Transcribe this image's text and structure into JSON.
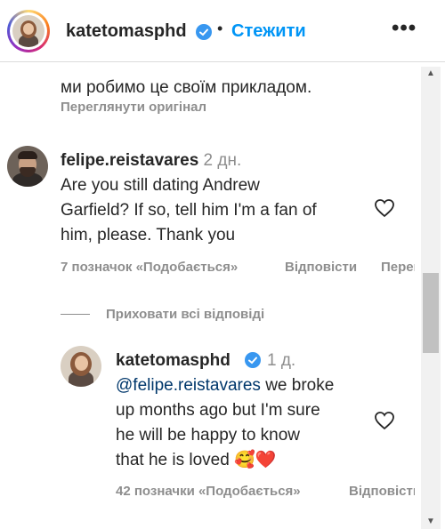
{
  "header": {
    "username": "katetomasphd",
    "separator": "•",
    "follow_label": "Стежити",
    "more_label": "•••"
  },
  "caption_tail": {
    "text": "ми робимо це своїм прикладом.",
    "see_original": "Переглянути оригінал"
  },
  "comment1": {
    "username": "felipe.reistavares",
    "time": "2 дн.",
    "lines": [
      "Are you still dating Andrew",
      "Garfield? If so, tell him I'm a fan of",
      "him, please. Thank you"
    ],
    "likes": "7 позначок «Подобається»",
    "reply": "Відповісти",
    "translate": "Переглянути переклад"
  },
  "hide_replies": "Приховати всі відповіді",
  "reply1": {
    "username": "katetomasphd",
    "time": "1 д.",
    "mention": "@felipe.reistavares",
    "line1_rest": " we broke",
    "lines": [
      "up months ago but I'm sure",
      "he will be happy to know",
      "that he is loved"
    ],
    "emoji": "🥰❤️",
    "likes": "42 позначки «Подобається»",
    "reply": "Відповісти"
  },
  "colors": {
    "accent": "#0095f6",
    "verified": "#3897f0",
    "muted": "#8e8e8e",
    "text": "#262626"
  }
}
